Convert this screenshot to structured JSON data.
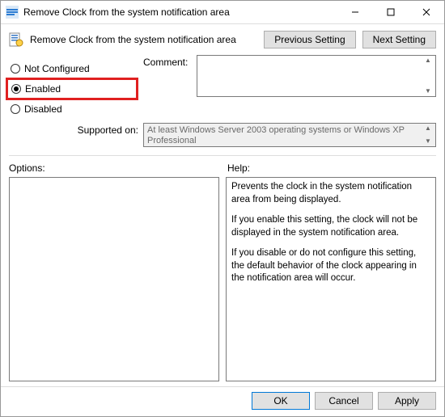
{
  "titlebar": {
    "title": "Remove Clock from the system notification area"
  },
  "header": {
    "policy_title": "Remove Clock from the system notification area",
    "prev_label": "Previous Setting",
    "next_label": "Next Setting"
  },
  "radios": {
    "not_configured": "Not Configured",
    "enabled": "Enabled",
    "disabled": "Disabled",
    "selected": "enabled"
  },
  "comment": {
    "label": "Comment:",
    "value": ""
  },
  "supported": {
    "label": "Supported on:",
    "text": "At least Windows Server 2003 operating systems or Windows XP Professional"
  },
  "panes": {
    "options_label": "Options:",
    "help_label": "Help:"
  },
  "help": {
    "p1": "Prevents the clock in the system notification area from being displayed.",
    "p2": "If you enable this setting, the clock will not be displayed in the system notification area.",
    "p3": "If you disable or do not configure this setting, the default behavior of the clock appearing in the notification area will occur."
  },
  "footer": {
    "ok": "OK",
    "cancel": "Cancel",
    "apply": "Apply"
  }
}
